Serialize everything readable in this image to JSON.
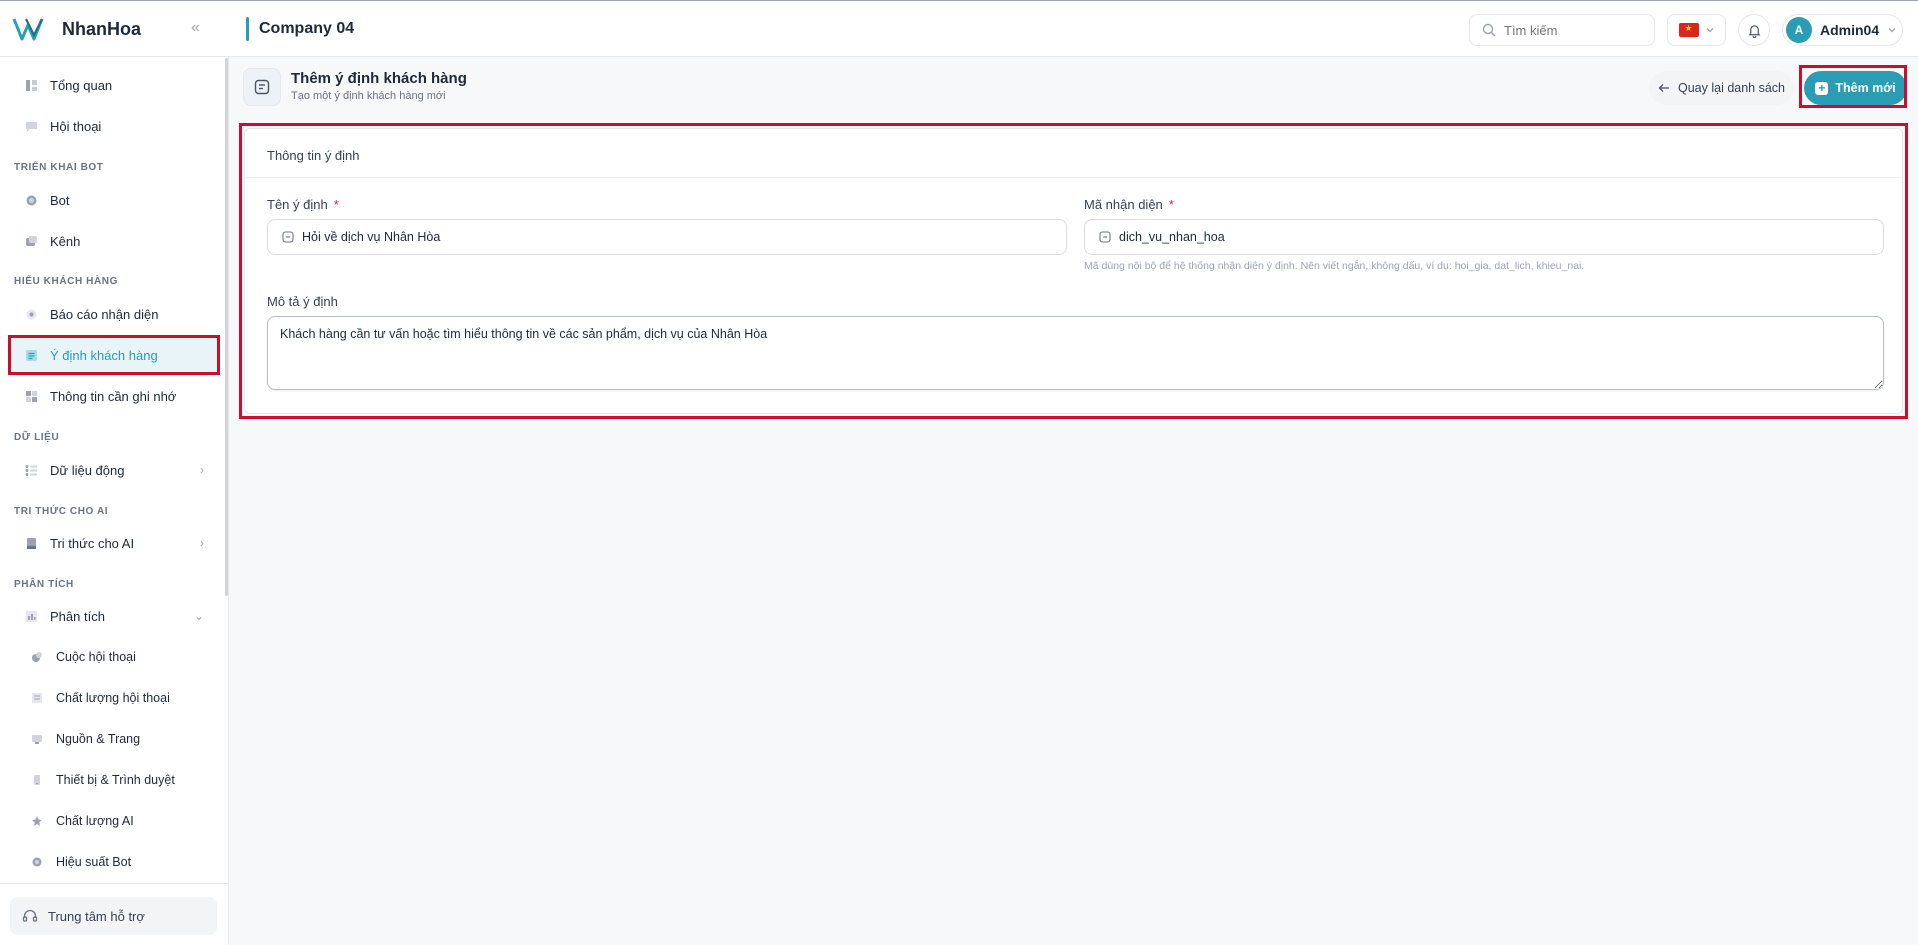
{
  "app": {
    "brand": "NhanHoa",
    "company": "Company 04"
  },
  "header": {
    "search_placeholder": "Tìm kiếm",
    "user_initial": "A",
    "user_name": "Admin04"
  },
  "sidebar": {
    "items_top": [
      {
        "label": "Tổng quan",
        "icon": "dashboard-icon"
      },
      {
        "label": "Hội thoại",
        "icon": "chat-icon"
      }
    ],
    "section_bot": "TRIỂN KHAI BOT",
    "items_bot": [
      {
        "label": "Bot",
        "icon": "bot-icon"
      },
      {
        "label": "Kênh",
        "icon": "channel-icon"
      }
    ],
    "section_customer": "HIỂU KHÁCH HÀNG",
    "items_customer": [
      {
        "label": "Báo cáo nhận diện",
        "icon": "report-icon"
      },
      {
        "label": "Ý định khách hàng",
        "icon": "intent-icon"
      },
      {
        "label": "Thông tin cần ghi nhớ",
        "icon": "memory-icon"
      }
    ],
    "section_data": "DỮ LIỆU",
    "item_data": {
      "label": "Dữ liệu động",
      "icon": "data-icon"
    },
    "section_ai": "TRI THỨC CHO AI",
    "item_ai": {
      "label": "Tri thức cho AI",
      "icon": "knowledge-icon"
    },
    "section_analysis": "PHÂN TÍCH",
    "item_analysis": {
      "label": "Phân tích",
      "icon": "analytics-icon"
    },
    "items_analysis_sub": [
      {
        "label": "Cuộc hội thoại",
        "icon": "conversation-icon"
      },
      {
        "label": "Chất lượng hội thoại",
        "icon": "quality-icon"
      },
      {
        "label": "Nguồn & Trang",
        "icon": "source-icon"
      },
      {
        "label": "Thiết bị & Trình duyệt",
        "icon": "device-icon"
      },
      {
        "label": "Chất lượng AI",
        "icon": "ai-quality-icon"
      },
      {
        "label": "Hiệu suất Bot",
        "icon": "performance-icon"
      }
    ],
    "support": "Trung tâm hỗ trợ"
  },
  "page": {
    "title": "Thêm ý định khách hàng",
    "subtitle": "Tạo một ý định khách hàng mới",
    "back_label": "Quay lại danh sách",
    "add_label": "Thêm mới"
  },
  "form": {
    "section_title": "Thông tin ý định",
    "name_label": "Tên ý định",
    "name_value": "Hỏi về dịch vụ Nhân Hòa",
    "code_label": "Mã nhận diện",
    "code_value": "dich_vu_nhan_hoa",
    "code_hint": "Mã dùng nội bộ để hệ thống nhận diện ý định. Nên viết ngắn, không dấu, ví dụ: hoi_gia, dat_lich, khieu_nai.",
    "required_mark": "*",
    "desc_label": "Mô tả ý định",
    "desc_value": "Khách hàng cần tư vấn hoặc tìm hiểu thông tin về các sản phẩm, dịch vụ của Nhân Hòa"
  },
  "colors": {
    "accent": "#2a9db5",
    "highlight": "#c8102e"
  }
}
